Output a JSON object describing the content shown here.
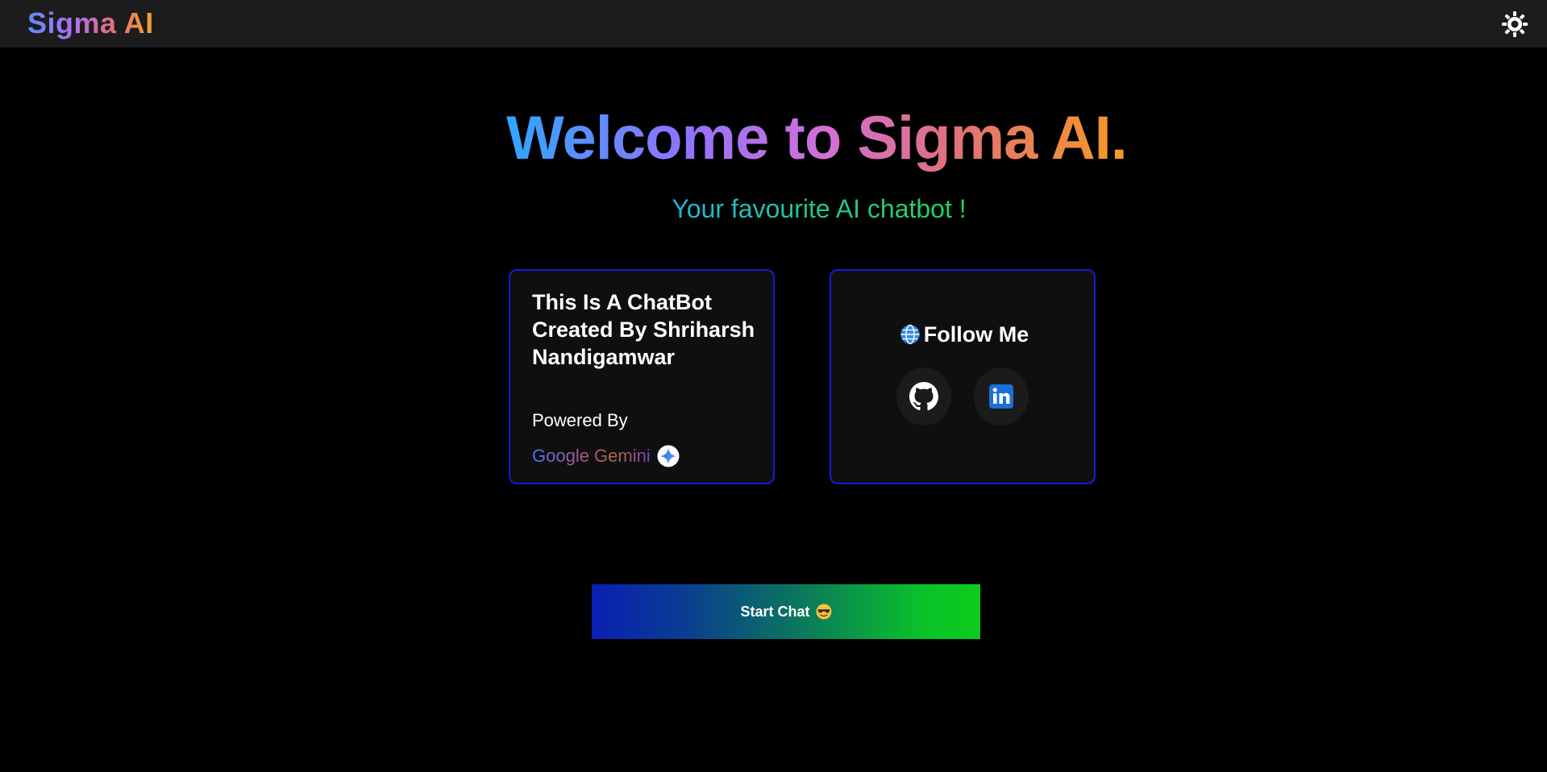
{
  "header": {
    "brand": "Sigma AI",
    "theme_icon": "sun-icon"
  },
  "hero": {
    "title": "Welcome to Sigma AI.",
    "subtitle": "Your favourite AI chatbot !"
  },
  "about_card": {
    "heading": "This Is A ChatBot Created By Shriharsh Nandigamwar",
    "powered_by": "Powered By",
    "powered_by_name": "Google Gemini",
    "powered_by_icon": "gemini-star-icon"
  },
  "follow_card": {
    "heading": "Follow Me",
    "heading_icon": "globe-icon",
    "links": [
      {
        "name": "GitHub",
        "icon": "github-icon"
      },
      {
        "name": "LinkedIn",
        "icon": "linkedin-icon"
      }
    ]
  },
  "cta": {
    "label": "Start Chat",
    "emoji_icon": "sunglasses-face-icon"
  },
  "colors": {
    "background": "#000000",
    "topbar": "#1c1c1c",
    "card_border": "#1a1ad6",
    "card_bg": "#0f0f0f",
    "cta_start": "#0a1fb5",
    "cta_end": "#0bcc1a"
  }
}
